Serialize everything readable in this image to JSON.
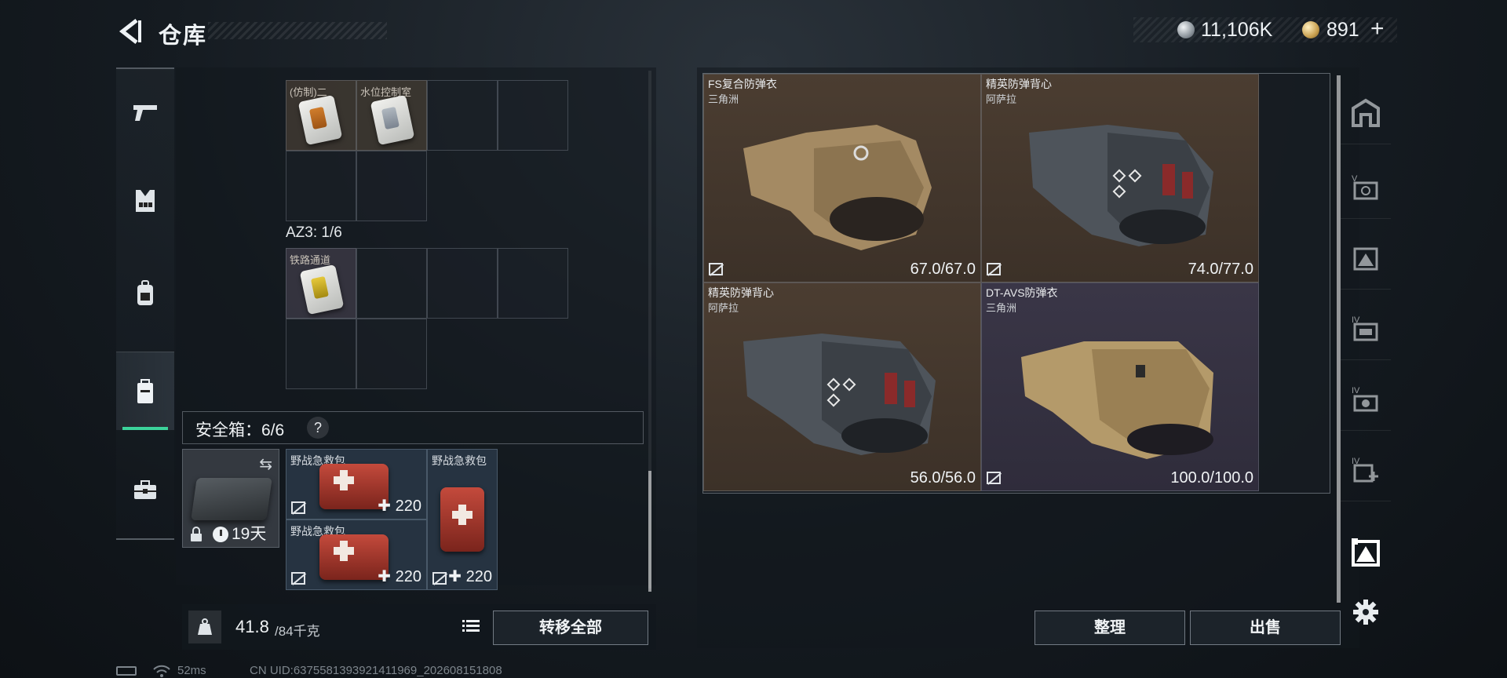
{
  "header": {
    "title": "仓库",
    "currency_silver": "11,106K",
    "currency_gold": "891",
    "gold_plus": "+"
  },
  "left_nav": {
    "items": [
      {
        "name": "weapons",
        "icon": "gun-icon"
      },
      {
        "name": "chest-rig",
        "icon": "vest-icon"
      },
      {
        "name": "backpack",
        "icon": "backpack-icon"
      },
      {
        "name": "safe-case",
        "icon": "case-icon",
        "active": true
      },
      {
        "name": "toolbox",
        "icon": "toolbox-icon"
      }
    ]
  },
  "storage": {
    "items_top": [
      {
        "label": "(仿制)二"
      },
      {
        "label": "水位控制室"
      }
    ],
    "az3_label": "AZ3: 1/6",
    "items_az3": [
      {
        "label": "铁路通道"
      }
    ]
  },
  "safe_box": {
    "label": "安全箱：6/6",
    "help": "?",
    "days": "19天",
    "items": [
      {
        "label": "野战急救包",
        "count": "220"
      },
      {
        "label": "野战急救包",
        "count": "220"
      },
      {
        "label": "野战急救包",
        "count": "220"
      }
    ]
  },
  "weight": {
    "current": "41.8",
    "max": "/84千克",
    "transfer_all": "转移全部"
  },
  "armor": [
    {
      "name": "FS复合防弹衣",
      "sub": "三角洲",
      "durability": "67.0/67.0",
      "bg": "brown"
    },
    {
      "name": "精英防弹背心",
      "sub": "阿萨拉",
      "durability": "74.0/77.0",
      "bg": "brown"
    },
    {
      "name": "精英防弹背心",
      "sub": "阿萨拉",
      "durability": "56.0/56.0",
      "bg": "brown"
    },
    {
      "name": "DT-AVS防弹衣",
      "sub": "三角洲",
      "durability": "100.0/100.0",
      "bg": "purple"
    }
  ],
  "actions": {
    "sort": "整理",
    "sell": "出售"
  },
  "right_nav": {
    "labels": [
      "",
      "V",
      "",
      "IV",
      "IV",
      "IV",
      ""
    ]
  },
  "status": {
    "ping": "52ms",
    "uid": "CN UID:6375581393921411969_202608151808"
  },
  "colors": {
    "accent_green": "#3cd39b",
    "brown_cell": "#4b3d31",
    "purple_cell": "#3a3647",
    "medkit_red": "#c44a3c"
  }
}
